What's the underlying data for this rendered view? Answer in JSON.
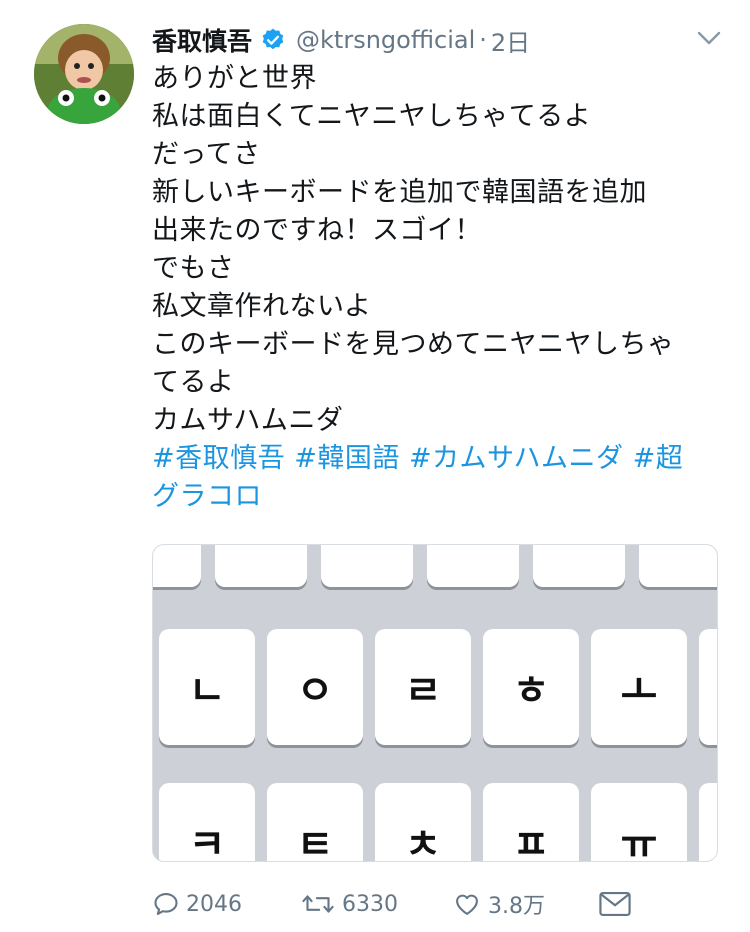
{
  "tweet": {
    "display_name": "香取慎吾",
    "handle": "@ktrsngofficial",
    "separator": "·",
    "time": "2日",
    "lines": [
      "ありがと世界",
      "私は面白くてニヤニヤしちゃてるよ",
      "だってさ",
      "新しいキーボードを追加で韓国語を追加",
      "出来たのですね！スゴイ！",
      "でもさ",
      "私文章作れないよ",
      "このキーボードを見つめてニヤニヤしちゃ",
      "てるよ",
      "カムサハムニダ"
    ],
    "hashtag_line1": [
      "#香取慎吾",
      "#韓国語",
      "#カムサハムニダ",
      "#超"
    ],
    "hashtag_line2": "グラコロ"
  },
  "media": {
    "keys_row_mid": [
      "ㄴ",
      "ㅇ",
      "ㄹ",
      "ㅎ",
      "ㅗ"
    ],
    "keys_row_bottom": [
      "ㅋ",
      "ㅌ",
      "ㅊ",
      "ㅍ",
      "ㅠ"
    ]
  },
  "actions": {
    "reply_count": "2046",
    "retweet_count": "6330",
    "like_count": "3.8万"
  },
  "colors": {
    "link": "#1b95e0",
    "secondary": "#657786",
    "verified": "#1da1f2"
  },
  "icons": [
    "avatar",
    "verified-badge-icon",
    "chevron-down-icon",
    "reply-icon",
    "retweet-icon",
    "like-icon",
    "message-icon"
  ]
}
